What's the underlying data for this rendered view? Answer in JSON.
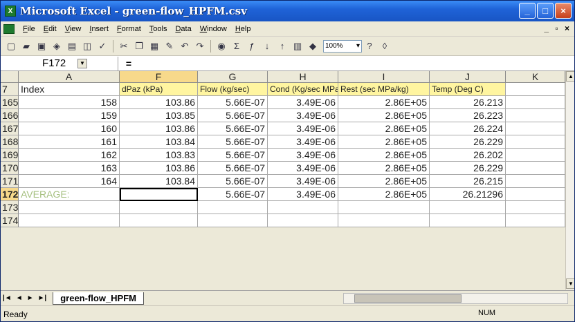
{
  "window": {
    "title": "Microsoft Excel - green-flow_HPFM.csv"
  },
  "menu": [
    "File",
    "Edit",
    "View",
    "Insert",
    "Format",
    "Tools",
    "Data",
    "Window",
    "Help"
  ],
  "toolbar": {
    "zoom": "100%"
  },
  "formula_bar": {
    "name_box": "F172",
    "equals": "="
  },
  "columns": [
    "A",
    "F",
    "G",
    "H",
    "I",
    "J",
    "K"
  ],
  "header_row": {
    "row_number": "7",
    "cells": [
      "Index",
      "dPaz (kPa)",
      "Flow (kg/sec)",
      "Cond (Kg/sec MPa)",
      "Rest (sec MPa/kg)",
      "Temp (Deg C)",
      ""
    ]
  },
  "rows": [
    {
      "row_number": "165",
      "cells": [
        "158",
        "103.86",
        "5.66E-07",
        "3.49E-06",
        "2.86E+05",
        "26.213",
        ""
      ]
    },
    {
      "row_number": "166",
      "cells": [
        "159",
        "103.85",
        "5.66E-07",
        "3.49E-06",
        "2.86E+05",
        "26.223",
        ""
      ]
    },
    {
      "row_number": "167",
      "cells": [
        "160",
        "103.86",
        "5.66E-07",
        "3.49E-06",
        "2.86E+05",
        "26.224",
        ""
      ]
    },
    {
      "row_number": "168",
      "cells": [
        "161",
        "103.84",
        "5.66E-07",
        "3.49E-06",
        "2.86E+05",
        "26.229",
        ""
      ]
    },
    {
      "row_number": "169",
      "cells": [
        "162",
        "103.83",
        "5.66E-07",
        "3.49E-06",
        "2.86E+05",
        "26.202",
        ""
      ]
    },
    {
      "row_number": "170",
      "cells": [
        "163",
        "103.86",
        "5.66E-07",
        "3.49E-06",
        "2.86E+05",
        "26.229",
        ""
      ]
    },
    {
      "row_number": "171",
      "cells": [
        "164",
        "103.84",
        "5.66E-07",
        "3.49E-06",
        "2.86E+05",
        "26.215",
        ""
      ]
    },
    {
      "row_number": "172",
      "cells": [
        "AVERAGE:",
        "",
        "5.66E-07",
        "3.49E-06",
        "2.86E+05",
        "26.21296",
        ""
      ]
    },
    {
      "row_number": "173",
      "cells": [
        "",
        "",
        "",
        "",
        "",
        "",
        ""
      ]
    },
    {
      "row_number": "174",
      "cells": [
        "",
        "",
        "",
        "",
        "",
        "",
        ""
      ]
    }
  ],
  "sheet_tabs": [
    "green-flow_HPFM"
  ],
  "status": {
    "left": "Ready",
    "num": "NUM"
  },
  "colors": {
    "title_bar": "#1f63d8",
    "header_yellow": "#fff5a0",
    "active_header": "#f7d98b",
    "average_label": "#a6c080"
  }
}
